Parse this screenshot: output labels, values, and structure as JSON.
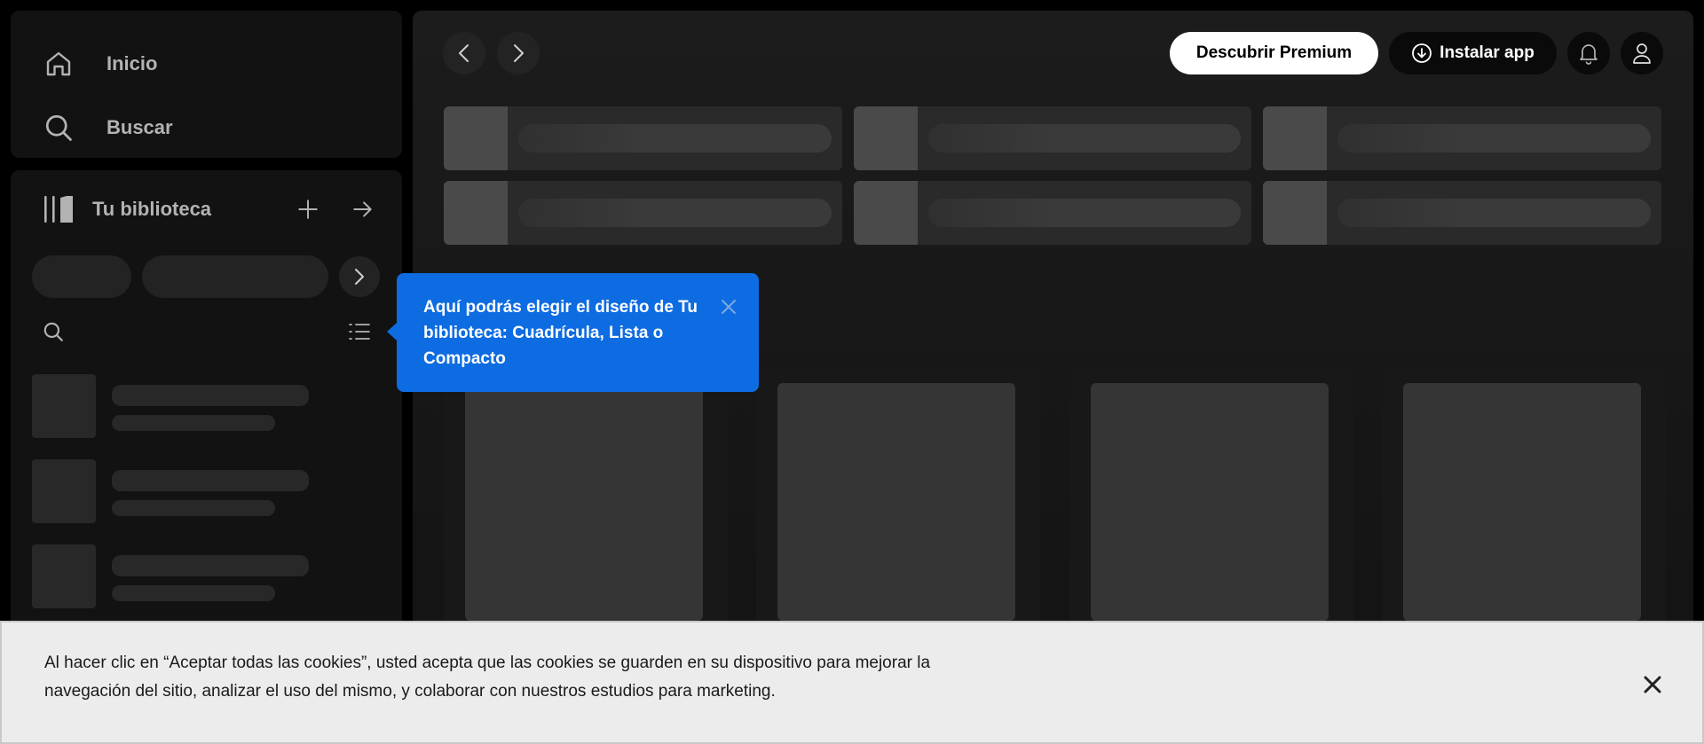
{
  "nav": {
    "home_label": "Inicio",
    "search_label": "Buscar"
  },
  "library": {
    "title": "Tu biblioteca"
  },
  "header": {
    "premium_label": "Descubrir Premium",
    "install_label": "Instalar app"
  },
  "tooltip": {
    "text": "Aquí podrás elegir el diseño de Tu biblioteca: Cuadrícula, Lista o Compacto"
  },
  "cookie_banner": {
    "text": "Al hacer clic en “Aceptar todas las cookies”, usted acepta que las cookies se guarden en su dispositivo para mejorar la navegación del sitio, analizar el uso del mismo, y colaborar con nuestros estudios para marketing."
  },
  "colors": {
    "background": "#000000",
    "panel": "#121212",
    "tooltip": "#0d6ce1",
    "skeleton": "#282828",
    "cookie_bg": "#ececec"
  },
  "icons": [
    "home-icon",
    "search-icon",
    "library-icon",
    "plus-icon",
    "arrow-right-icon",
    "chevron-right-icon",
    "list-icon",
    "chevron-left-icon",
    "download-icon",
    "bell-icon",
    "user-icon",
    "close-icon"
  ]
}
